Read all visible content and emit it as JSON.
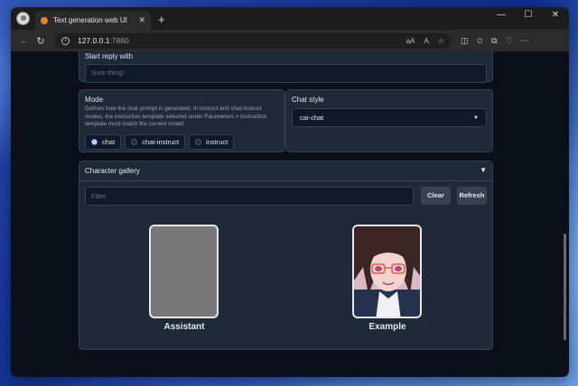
{
  "browser": {
    "tab_title": "Text generation web UI",
    "tab_close": "✕",
    "new_tab": "+",
    "url_host": "127.0.0.1",
    "url_port": ":7860",
    "window_controls": [
      "—",
      "☐",
      "✕"
    ],
    "icons": [
      "back-icon",
      "refresh-icon",
      "info-icon",
      "read-aloud-icon",
      "text-size-icon",
      "favorite-icon",
      "split-screen-icon",
      "favorites-icon",
      "collections-icon",
      "extensions-icon",
      "more-icon"
    ]
  },
  "start_reply": {
    "label": "Start reply with",
    "placeholder": "Sure thing!"
  },
  "mode": {
    "label": "Mode",
    "description": "Defines how the chat prompt is generated. In instruct and chat-instruct modes, the instruction template selected under Parameters > Instruction template must match the current model.",
    "options": [
      "chat",
      "chat-instruct",
      "instruct"
    ],
    "selected": "chat"
  },
  "chat_style": {
    "label": "Chat style",
    "value": "cai-chat"
  },
  "gallery": {
    "label": "Character gallery",
    "toggle": "▼",
    "filter_placeholder": "Filter",
    "clear_label": "Clear",
    "refresh_label": "Refresh",
    "characters": [
      "Assistant",
      "Example"
    ]
  },
  "colors": {
    "page_bg": "#0b0f19",
    "panel_bg": "#1f2937",
    "accent": "#3b82f6"
  }
}
